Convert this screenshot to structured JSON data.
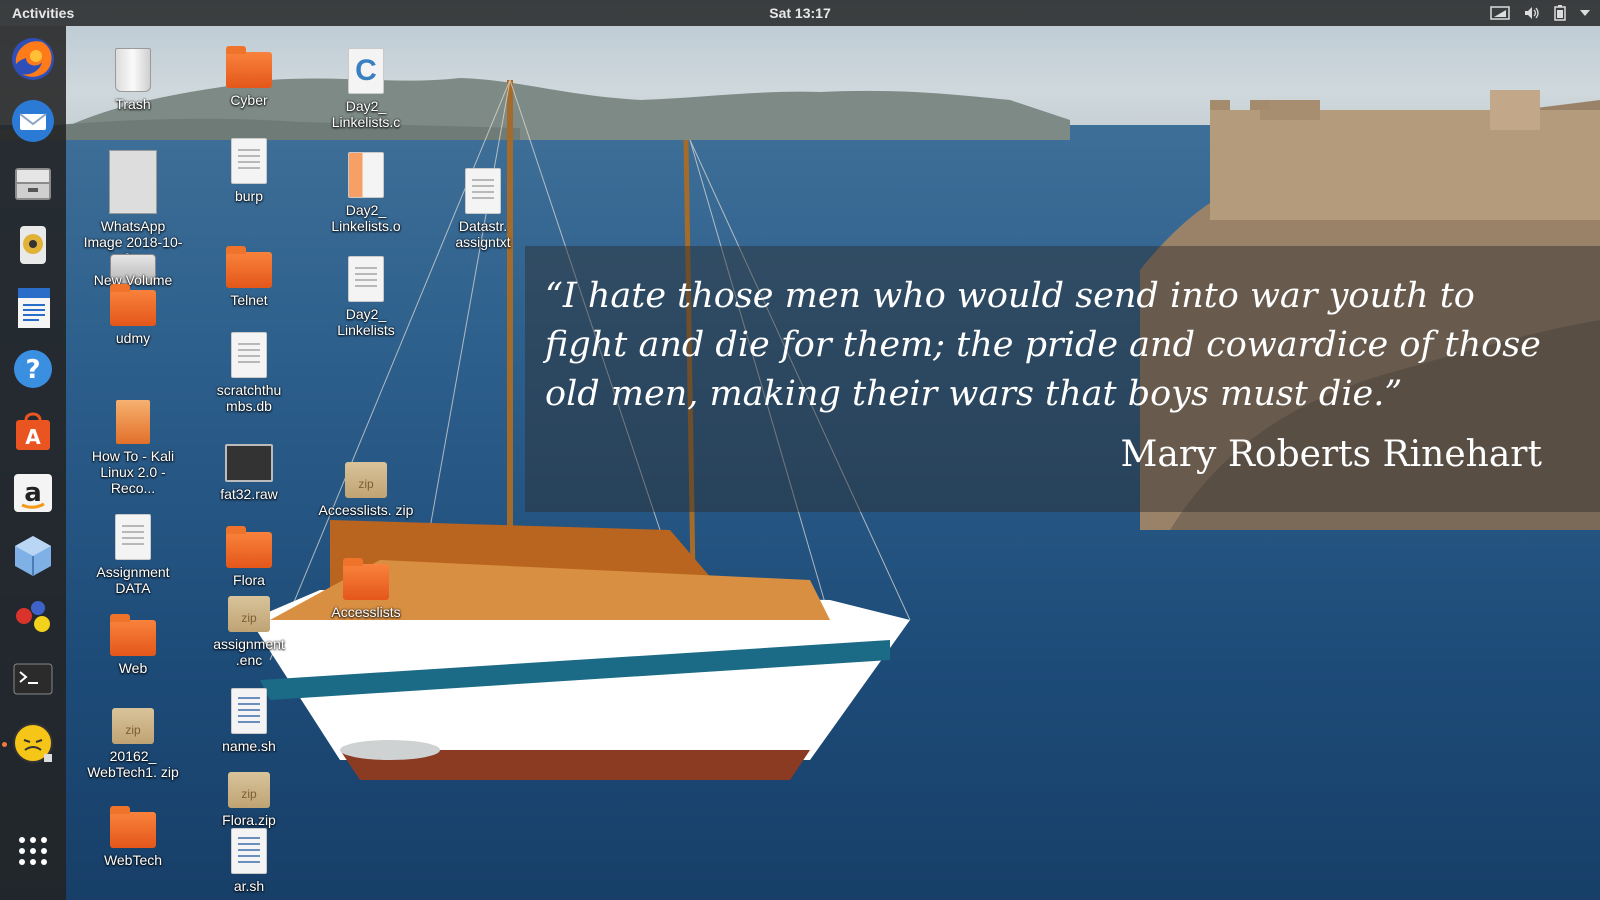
{
  "topbar": {
    "activities": "Activities",
    "clock": "Sat 13:17",
    "icons": [
      "network-icon",
      "volume-icon",
      "battery-icon",
      "system-menu-arrow-icon"
    ]
  },
  "dock": {
    "items": [
      "firefox",
      "thunderbird",
      "files",
      "rhythmbox",
      "libreoffice-writer",
      "help",
      "ubuntu-software",
      "amazon",
      "virtualbox",
      "maltego",
      "terminal",
      "burpsuite"
    ],
    "show_apps": "show-applications-icon"
  },
  "desktop": {
    "col1": [
      "Trash",
      "WhatsApp Image 2018-10-2...",
      "New Volume",
      "udmy",
      "How To - Kali Linux 2.0 - Reco...",
      "Assignment DATA",
      "Web",
      "20162_ WebTech1. zip",
      "WebTech"
    ],
    "col2": [
      "Cyber",
      "burp",
      "Telnet",
      "scratchthu mbs.db",
      "fat32.raw",
      "Flora",
      "assignment .enc",
      "name.sh",
      "Flora.zip",
      "ar.sh"
    ],
    "col3": [
      "Day2_ Linkelists.c",
      "Day2_ Linkelists.o",
      "Day2_ Linkelists",
      "Accesslists. zip",
      "Accesslists"
    ],
    "col4": [
      "Datastr. assigntxt"
    ]
  },
  "quote": {
    "text": "“I hate those men who would send into war youth to fight and die for them; the pride and cowardice of those old men, making their wars that boys must die.”",
    "author": "Mary Roberts Rinehart"
  },
  "colors": {
    "topbar": "#1e1e1e",
    "dock": "#232323",
    "folder_orange": "#f27a3e",
    "sea": "#2d5f8c"
  }
}
